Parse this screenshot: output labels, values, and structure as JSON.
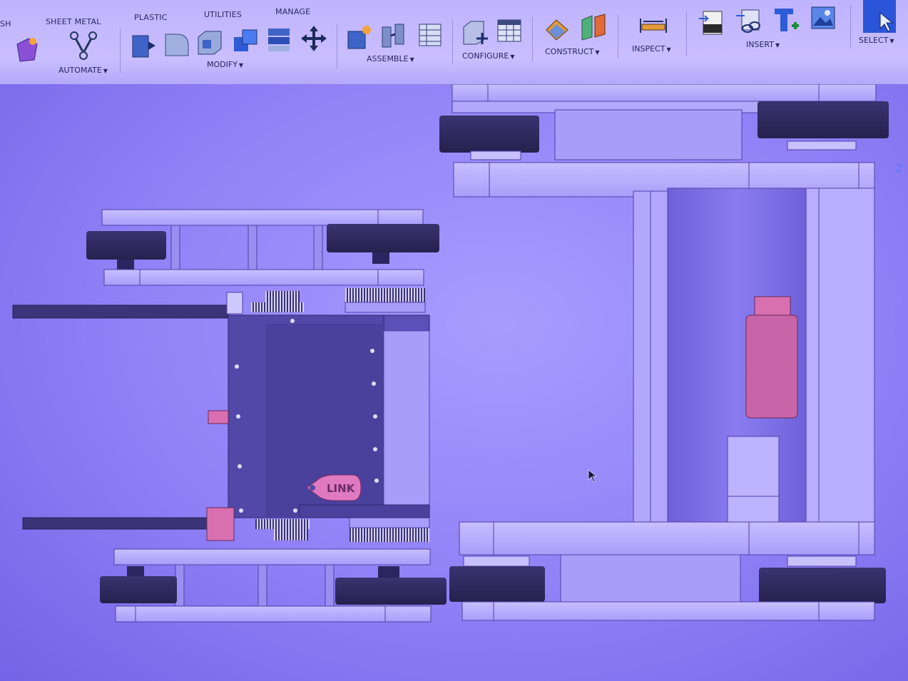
{
  "toolbar": {
    "tabs": [
      "SH",
      "SHEET METAL",
      "PLASTIC",
      "UTILITIES",
      "MANAGE"
    ],
    "groups": {
      "automate": "AUTOMATE",
      "modify": "MODIFY",
      "assemble": "ASSEMBLE",
      "configure": "CONFIGURE",
      "construct": "CONSTRUCT",
      "inspect": "INSPECT",
      "insert": "INSERT",
      "select": "SELECT"
    },
    "caret": "▼"
  },
  "canvas": {
    "link_badge": "LINK",
    "view_label": "Z"
  },
  "colors": {
    "toolbar_bg": "#c3b8ff",
    "canvas_bg": "#8f80f6",
    "frame": "#b7abff",
    "dark_part": "#3a3370",
    "motor_body": "#5248a8",
    "pink_part": "#e07ac0",
    "accent": "#2e5bd6"
  }
}
